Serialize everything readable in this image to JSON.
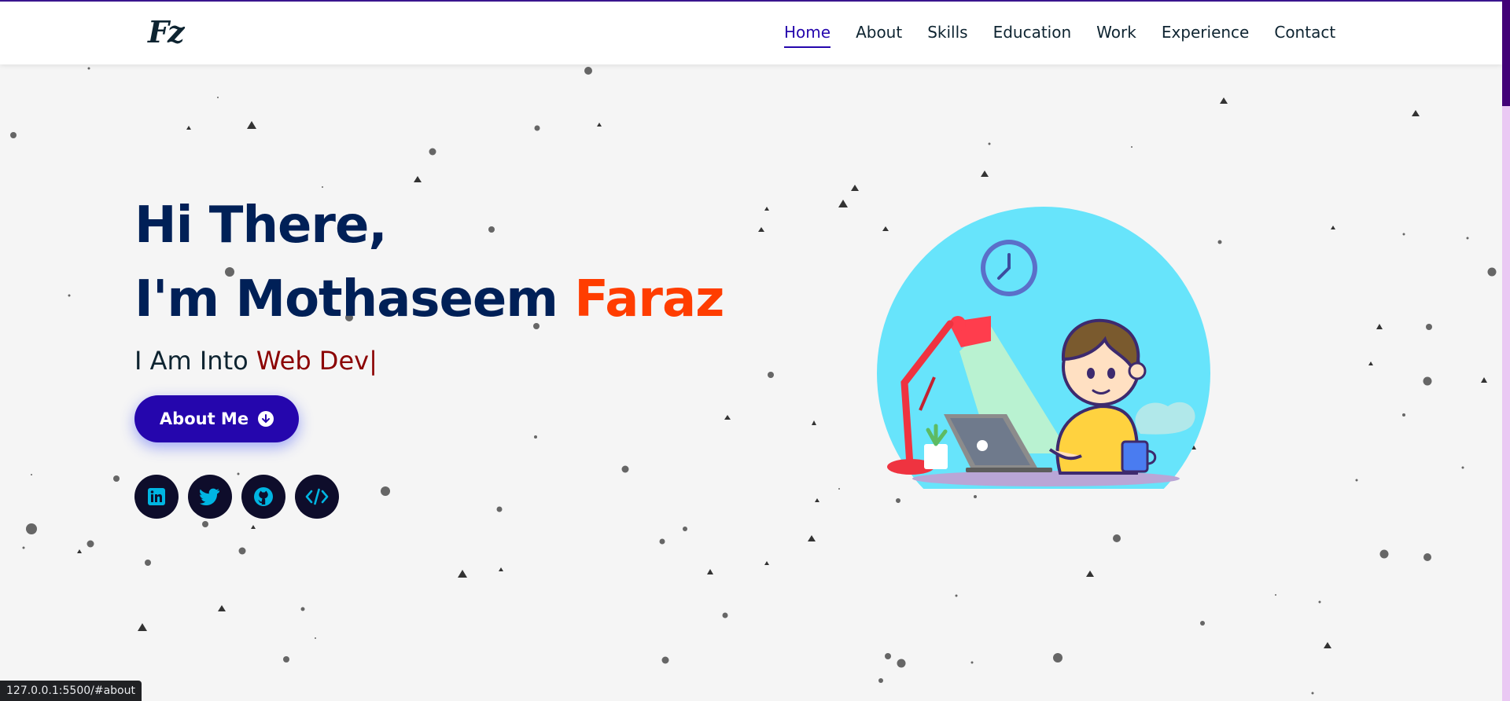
{
  "navbar": {
    "logo_text": "Fz",
    "links": [
      "Home",
      "About",
      "Skills",
      "Education",
      "Work",
      "Experience",
      "Contact"
    ],
    "active": "Home"
  },
  "hero": {
    "greeting": "Hi There,",
    "intro_prefix": "I'm Mothaseem ",
    "intro_accent": "Faraz",
    "typing_prefix": "I Am Into ",
    "typing_value": "Web Dev",
    "typing_cursor": "|",
    "button_label": "About Me",
    "socials": [
      "linkedin-icon",
      "twitter-icon",
      "github-icon",
      "code-icon"
    ]
  },
  "status_bar": {
    "url": "127.0.0.1:5500/#about"
  },
  "colors": {
    "primary": "#2506ad",
    "heading": "#002057",
    "accent": "#ff3d00",
    "typed": "#8b0000",
    "scroll_thumb": "#420177"
  }
}
